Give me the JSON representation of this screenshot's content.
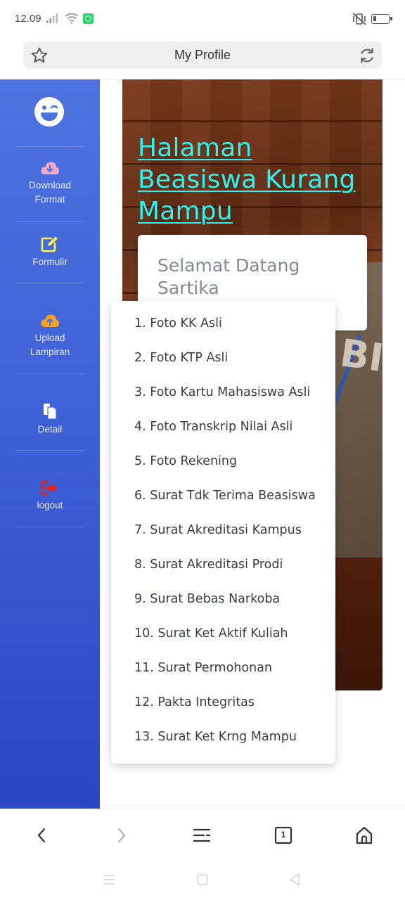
{
  "status_bar": {
    "time": "12.09"
  },
  "address_bar": {
    "title": "My Profile"
  },
  "sidebar": {
    "items": [
      {
        "icon": "cloud-download-icon",
        "color": "#f7a8c4",
        "label_line1": "Download",
        "label_line2": "Format"
      },
      {
        "icon": "edit-icon",
        "color": "#f5f542",
        "label_line1": "Formulir",
        "label_line2": ""
      },
      {
        "icon": "cloud-upload-icon",
        "color": "#f6a21e",
        "label_line1": "Upload",
        "label_line2": "Lampiran"
      },
      {
        "icon": "copy-icon",
        "color": "#ffffff",
        "label_line1": "Detail",
        "label_line2": ""
      },
      {
        "icon": "sign-out-icon",
        "color": "#e02424",
        "label_line1": "logout",
        "label_line2": ""
      }
    ]
  },
  "hero": {
    "title": "Halaman Beasiswa Kurang Mampu",
    "bag_letters": "BIK"
  },
  "welcome": {
    "text": "Selamat Datang Sartika"
  },
  "dropdown": {
    "items": [
      "1. Foto KK Asli",
      "2. Foto KTP Asli",
      "3. Foto Kartu Mahasiswa Asli",
      "4. Foto Transkrip Nilai Asli",
      "5. Foto Rekening",
      "6. Surat Tdk Terima Beasiswa",
      "7. Surat Akreditasi Kampus",
      "8. Surat Akreditasi Prodi",
      "9. Surat Bebas Narkoba",
      "10. Surat Ket Aktif Kuliah",
      "11. Surat Permohonan",
      "12. Pakta Integritas",
      "13. Surat Ket Krng Mampu"
    ]
  },
  "bottom_nav": {
    "tab_count": "1"
  },
  "colors": {
    "sidebar_top": "#4e73df",
    "sidebar_bottom": "#2a46c4",
    "title_cyan": "#2ef2f2"
  }
}
